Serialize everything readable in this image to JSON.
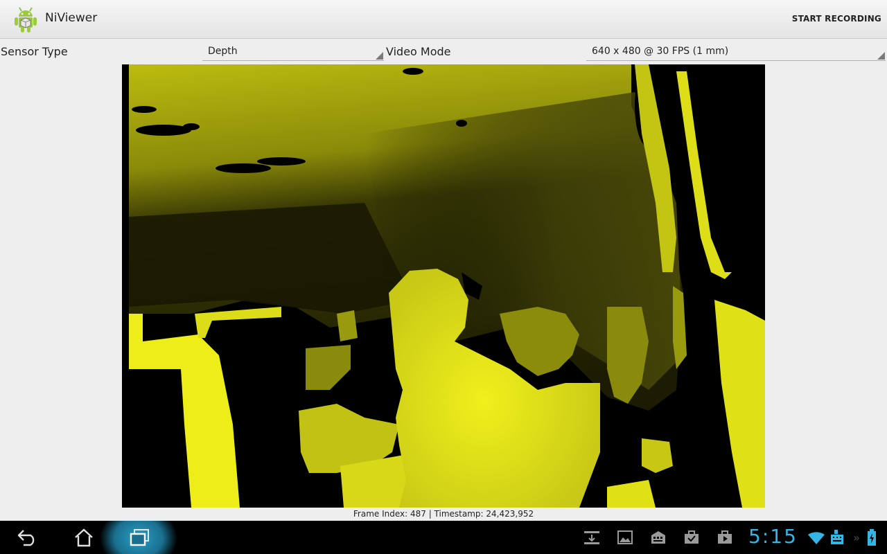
{
  "action_bar": {
    "app_title": "NiViewer",
    "app_icon": "android-robot-icon",
    "start_recording_label": "START RECORDING"
  },
  "controls": {
    "sensor_type_label": "Sensor Type",
    "sensor_type_value": "Depth",
    "video_mode_label": "Video Mode",
    "video_mode_value": "640 x 480 @ 30 FPS (1 mm)"
  },
  "viewer": {
    "content": "depth-image",
    "colors": {
      "near": "#f2f21a",
      "far": "#3c3c06",
      "no_data": "#000000"
    },
    "frame_info": "Frame Index: 487 | Timestamp: 24,423,952"
  },
  "system_bar": {
    "nav_icons": [
      "back-icon",
      "home-icon",
      "recent-apps-icon"
    ],
    "status_icons": [
      "download-icon",
      "gallery-icon",
      "keyboard-icon",
      "task-icon",
      "play-store-icon",
      "wifi-icon",
      "keyboard-input-icon",
      "battery-icon"
    ],
    "clock": "5:15",
    "accent_color": "#33b5e5"
  }
}
